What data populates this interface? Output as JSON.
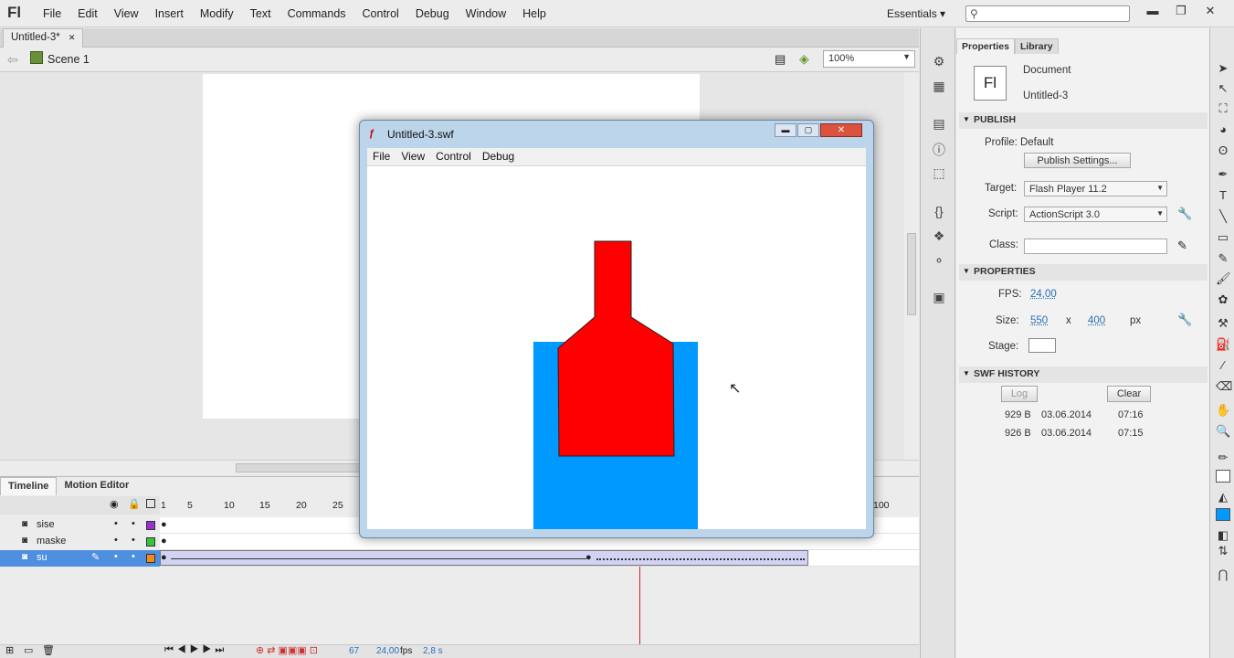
{
  "app": {
    "logo": "Fl",
    "menus": [
      "File",
      "Edit",
      "View",
      "Insert",
      "Modify",
      "Text",
      "Commands",
      "Control",
      "Debug",
      "Window",
      "Help"
    ],
    "workspace": "Essentials ▾",
    "search_placeholder": "",
    "search_icon": "search-icon"
  },
  "window_controls": {
    "minimize": "▬",
    "restore": "❐",
    "close": "✕"
  },
  "document": {
    "tab_label": "Untitled-3*",
    "tab_close": "✕"
  },
  "scene": {
    "label": "Scene 1",
    "zoom": "100%"
  },
  "timeline": {
    "tabs": [
      "Timeline",
      "Motion Editor"
    ],
    "frame_numbers": [
      "1",
      "5",
      "10",
      "15",
      "20",
      "25"
    ],
    "frame_number_far": "100",
    "layers": [
      {
        "name": "sise",
        "color": "#9b2fd0"
      },
      {
        "name": "maske",
        "color": "#35c33a"
      },
      {
        "name": "su",
        "color": "#f08a1c"
      }
    ],
    "status": {
      "current_frame": "67",
      "fps": "24,00",
      "fps_unit": "fps",
      "time": "2,8 s"
    }
  },
  "properties": {
    "tabs": [
      "Properties",
      "Library"
    ],
    "doc_icon": "Fl",
    "doc_type": "Document",
    "doc_name": "Untitled-3",
    "publish": {
      "header": "PUBLISH",
      "profile": "Profile: Default",
      "settings_btn": "Publish Settings...",
      "target_label": "Target:",
      "target": "Flash Player 11.2",
      "script_label": "Script:",
      "script": "ActionScript 3.0",
      "class_label": "Class:",
      "class_value": ""
    },
    "props": {
      "header": "PROPERTIES",
      "fps_label": "FPS:",
      "fps": "24,00",
      "size_label": "Size:",
      "width": "550",
      "x": "x",
      "height": "400",
      "unit": "px",
      "stage_label": "Stage:",
      "stage_color": "#ffffff"
    },
    "history": {
      "header": "SWF HISTORY",
      "log_btn": "Log",
      "clear_btn": "Clear",
      "rows": [
        {
          "size": "929 B",
          "date": "03.06.2014",
          "time": "07:16"
        },
        {
          "size": "926 B",
          "date": "03.06.2014",
          "time": "07:15"
        }
      ]
    }
  },
  "swf_window": {
    "title": "Untitled-3.swf",
    "menus": [
      "File",
      "View",
      "Control",
      "Debug"
    ],
    "water_color": "#0099ff",
    "bottle_color": "#ff0000"
  }
}
